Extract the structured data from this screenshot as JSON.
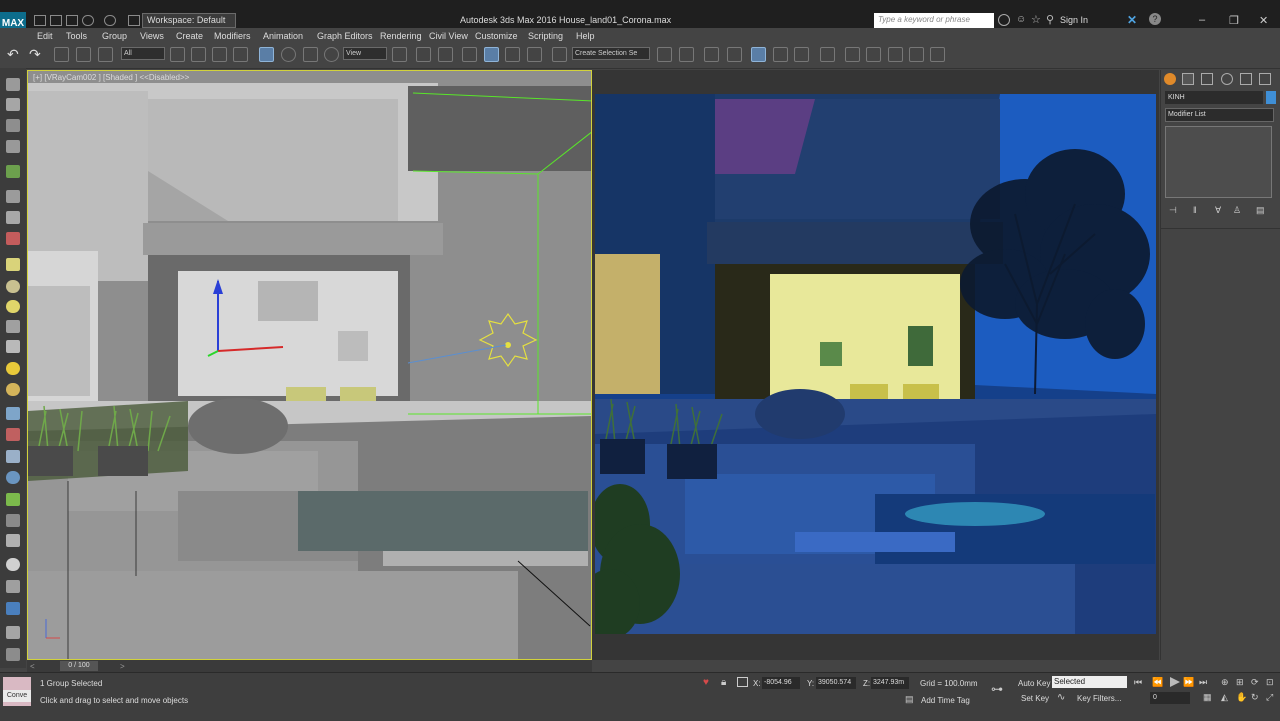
{
  "titlebar": {
    "workspace": "Workspace: Default",
    "app_title": "Autodesk 3ds Max 2016    House_land01_Corona.max",
    "search_placeholder": "Type a keyword or phrase",
    "signin": "Sign In",
    "logo": "MAX"
  },
  "menus": [
    "Edit",
    "Tools",
    "Group",
    "Views",
    "Create",
    "Modifiers",
    "Animation",
    "Graph Editors",
    "Rendering",
    "Civil View",
    "Customize",
    "Scripting",
    "Help"
  ],
  "toolbar": {
    "filter": "All",
    "coord_system": "View",
    "selection_set": "Create Selection Se"
  },
  "viewport": {
    "label": "[+] [VRayCam002 ] [Shaded ] <<Disabled>>"
  },
  "command_panel": {
    "object_name": "KINH",
    "modifier_list": "Modifier List",
    "object_color": "#3f8fd6"
  },
  "timeline": {
    "frame_label": "0 / 100"
  },
  "status": {
    "selection": "1 Group Selected",
    "prompt": "Click and drag to select and move objects",
    "x_label": "X:",
    "x_value": "-8054.96 ",
    "y_label": "Y:",
    "y_value": "39050.574",
    "z_label": "Z:",
    "z_value": "3247.93m",
    "grid": "Grid = 100.0mm",
    "add_time_tag": "Add Time Tag",
    "auto_key": "Auto Key",
    "set_key": "Set Key",
    "selected": "Selected",
    "key_filters": "Key Filters...",
    "frame": "0",
    "maxscript": "Conve"
  }
}
